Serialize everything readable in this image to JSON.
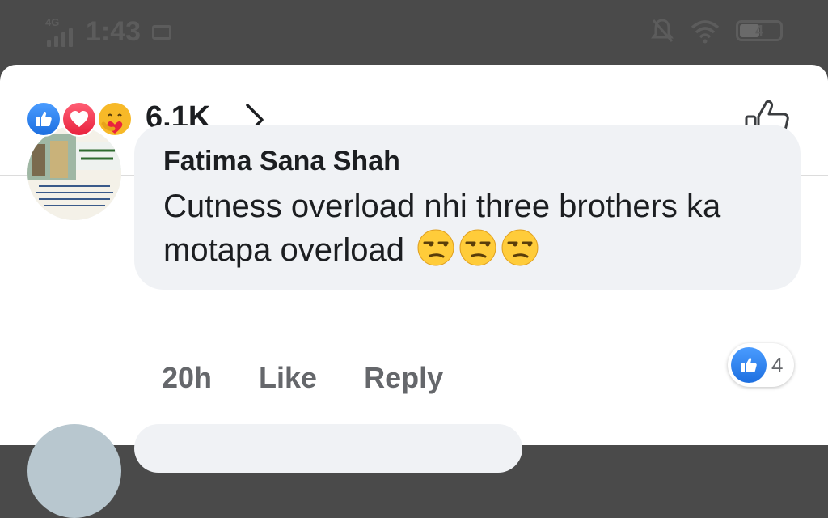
{
  "status_bar": {
    "network": "4G",
    "time": "1:43",
    "battery": "4"
  },
  "reactions": {
    "icons": [
      "like-icon",
      "love-icon",
      "care-icon"
    ],
    "count": "6.1K"
  },
  "comment": {
    "author": "Fatima Sana Shah",
    "text": "Cutness overload nhi three brothers ka motapa overload",
    "emojis": [
      "unamused-face",
      "unamused-face",
      "unamused-face"
    ],
    "time": "20h",
    "like_label": "Like",
    "reply_label": "Reply",
    "like_count": "4"
  },
  "colors": {
    "like_blue": "#1d6fe0",
    "love_red": "#e9233e",
    "care_yellow": "#f7b928",
    "bubble_bg": "#f0f2f5",
    "secondary_text": "#65676b"
  }
}
